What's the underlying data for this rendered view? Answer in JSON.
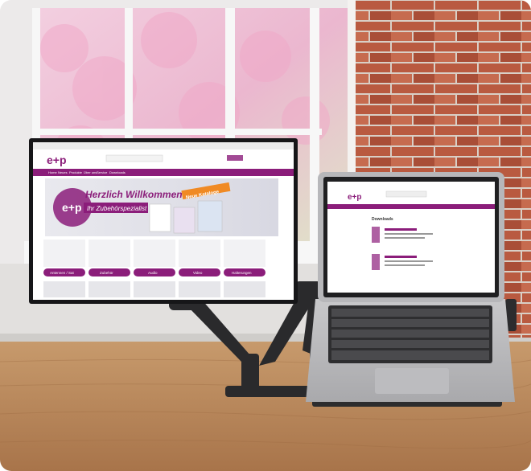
{
  "monitor_site": {
    "logo": "e+p",
    "nav": [
      "Home",
      "Neues",
      "Produkte",
      "Über uns",
      "Service",
      "Downloads"
    ],
    "banner_title": "Herzlich Willkommen!",
    "banner_subtitle": "Ihr Zubehörspezialist",
    "badge": "Neue Kataloge",
    "categories": [
      "Antennen / Sat",
      "Zubehör",
      "Audio",
      "Video",
      "Halterungen"
    ]
  },
  "laptop_site": {
    "logo": "e+p",
    "section_title": "Downloads"
  },
  "colors": {
    "brand": "#8b1d7a",
    "brick": "#b5573f",
    "wood": "#b9865a"
  }
}
